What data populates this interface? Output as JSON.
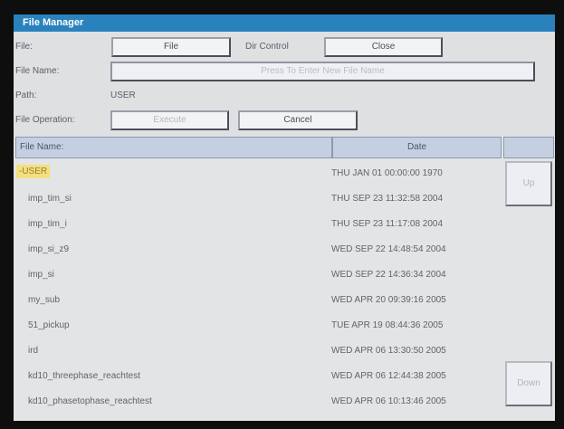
{
  "window": {
    "title": "File Manager"
  },
  "form": {
    "file_label": "File:",
    "file_button": "File",
    "dir_control_label": "Dir Control",
    "close_button": "Close",
    "file_name_label": "File Name:",
    "file_name_placeholder": "Press To Enter New File Name",
    "path_label": "Path:",
    "path_value": "USER",
    "file_operation_label": "File Operation:",
    "execute_button": "Execute",
    "cancel_button": "Cancel"
  },
  "table": {
    "columns": {
      "name": "File Name:",
      "date": "Date"
    },
    "rows": [
      {
        "name": "-USER",
        "date": "THU JAN 01 00:00:00 1970"
      },
      {
        "name": "imp_tim_si",
        "date": "THU SEP 23 11:32:58 2004"
      },
      {
        "name": "imp_tim_i",
        "date": "THU SEP 23 11:17:08 2004"
      },
      {
        "name": "imp_si_z9",
        "date": "WED SEP 22 14:48:54 2004"
      },
      {
        "name": "imp_si",
        "date": "WED SEP 22 14:36:34 2004"
      },
      {
        "name": "my_sub",
        "date": "WED APR 20 09:39:16 2005"
      },
      {
        "name": "51_pickup",
        "date": "TUE APR 19 08:44:36 2005"
      },
      {
        "name": "ird",
        "date": "WED APR 06 13:30:50 2005"
      },
      {
        "name": "kd10_threephase_reachtest",
        "date": "WED APR 06 12:44:38 2005"
      },
      {
        "name": "kd10_phasetophase_reachtest",
        "date": "WED APR 06 10:13:46 2005"
      }
    ]
  },
  "scroll": {
    "up_label": "Up",
    "down_label": "Down"
  },
  "colors": {
    "titlebar": "#2a82bd",
    "header": "#c4d0e2",
    "selection": "#f3e07f",
    "background": "#dfe0e2"
  }
}
